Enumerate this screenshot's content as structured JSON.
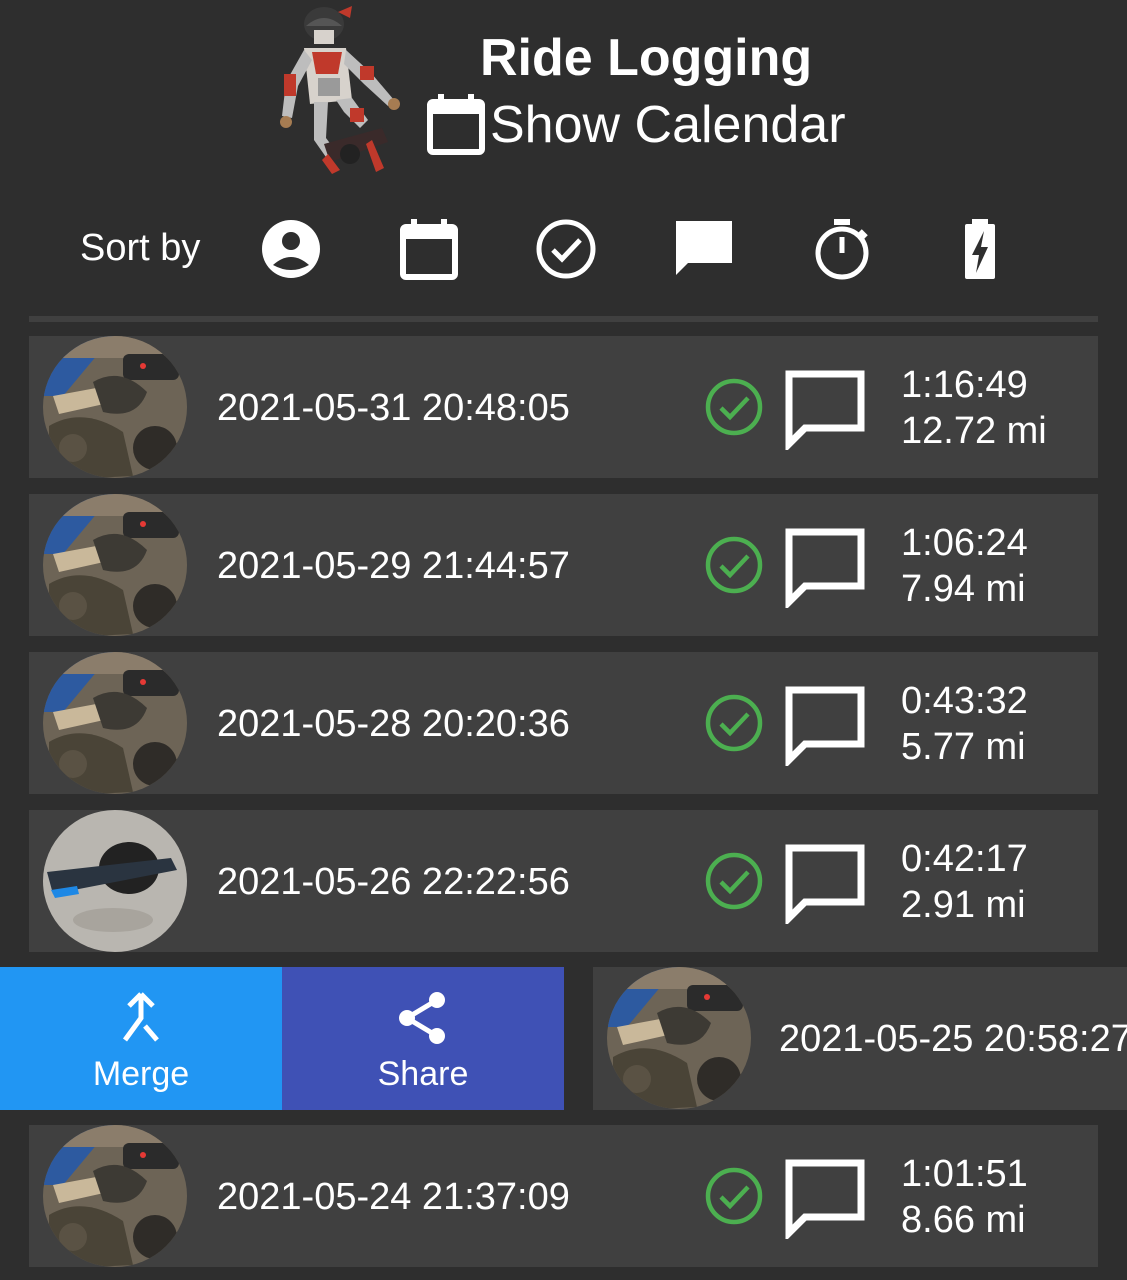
{
  "header": {
    "title": "Ride Logging",
    "show_calendar_label": "Show Calendar"
  },
  "sort_bar": {
    "label": "Sort by",
    "options": [
      {
        "icon": "account-circle-icon"
      },
      {
        "icon": "calendar-icon"
      },
      {
        "icon": "check-circle-icon"
      },
      {
        "icon": "comment-icon"
      },
      {
        "icon": "stopwatch-icon"
      },
      {
        "icon": "battery-charging-icon"
      }
    ]
  },
  "rides": [
    {
      "date": "2021-05-31 20:48:05",
      "duration": "1:16:49",
      "distance": "12.72 mi",
      "thumb": "board-photo",
      "status": "check-circle-icon"
    },
    {
      "date": "2021-05-29 21:44:57",
      "duration": "1:06:24",
      "distance": "7.94 mi",
      "thumb": "board-photo",
      "status": "check-circle-icon"
    },
    {
      "date": "2021-05-28 20:20:36",
      "duration": "0:43:32",
      "distance": "5.77 mi",
      "thumb": "board-photo",
      "status": "check-circle-icon"
    },
    {
      "date": "2021-05-26 22:22:56",
      "duration": "0:42:17",
      "distance": "2.91 mi",
      "thumb": "onewheel-photo",
      "status": "check-circle-icon"
    }
  ],
  "swiped_ride": {
    "date": "2021-05-25 20:58:27",
    "thumb": "board-photo",
    "actions": [
      {
        "label": "Merge",
        "icon": "merge-icon",
        "color": "#2196f3"
      },
      {
        "label": "Share",
        "icon": "share-icon",
        "color": "#3f51b5"
      }
    ]
  },
  "last_ride": {
    "date": "2021-05-24 21:37:09",
    "duration": "1:01:51",
    "distance": "8.66 mi",
    "thumb": "board-photo",
    "status": "check-circle-icon"
  },
  "colors": {
    "background": "#2e2e2e",
    "row": "#404040",
    "check_green": "#4caf50",
    "merge": "#2196f3",
    "share": "#3f51b5"
  }
}
